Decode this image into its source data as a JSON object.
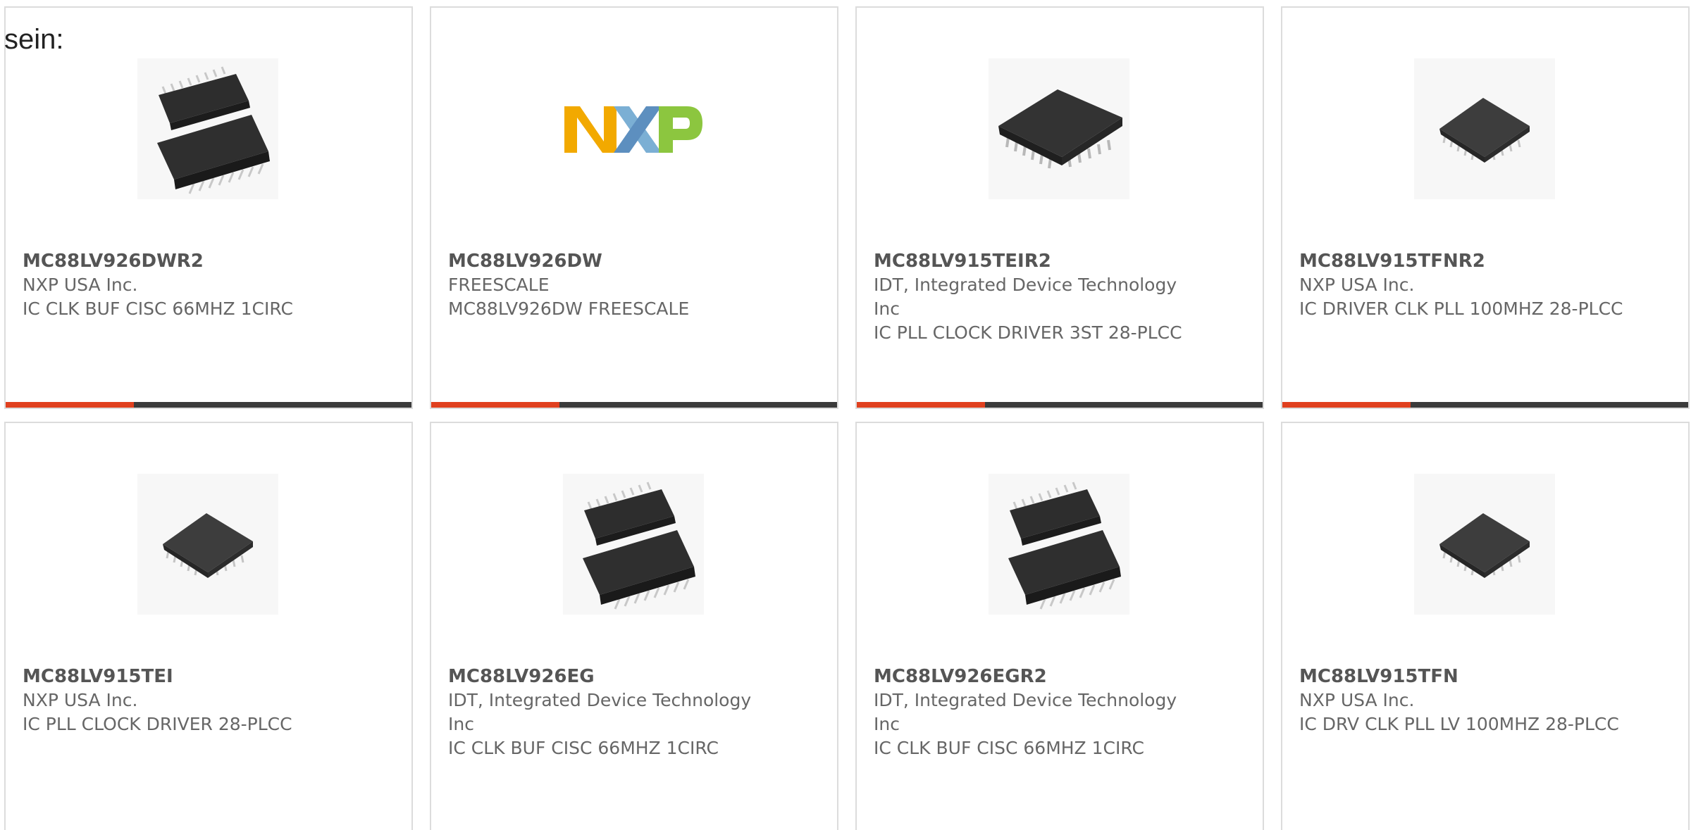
{
  "heading": "sein:",
  "colors": {
    "accent": "#e0401f",
    "bar": "#3b3b3b",
    "border": "#dcdcdc"
  },
  "products": [
    {
      "part": "MC88LV926DWR2",
      "manufacturer": "NXP USA Inc.",
      "description": "IC CLK BUF CISC 66MHZ 1CIRC",
      "image": "soic-chip-pair"
    },
    {
      "part": "MC88LV926DW",
      "manufacturer": "FREESCALE",
      "description": "MC88LV926DW FREESCALE",
      "image": "nxp-logo",
      "logo_text": "NXP"
    },
    {
      "part": "MC88LV915TEIR2",
      "manufacturer": "IDT, Integrated Device Technology Inc",
      "description": "IC PLL CLOCK DRIVER 3ST 28-PLCC",
      "image": "plcc-chip-large"
    },
    {
      "part": "MC88LV915TFNR2",
      "manufacturer": "NXP USA Inc.",
      "description": "IC DRIVER CLK PLL 100MHZ 28-PLCC",
      "image": "plcc-chip-small"
    },
    {
      "part": "MC88LV915TEI",
      "manufacturer": "NXP USA Inc.",
      "description": "IC PLL CLOCK DRIVER 28-PLCC",
      "image": "plcc-chip-small"
    },
    {
      "part": "MC88LV926EG",
      "manufacturer": "IDT, Integrated Device Technology Inc",
      "description": "IC CLK BUF CISC 66MHZ 1CIRC",
      "image": "soic-chip-pair"
    },
    {
      "part": "MC88LV926EGR2",
      "manufacturer": "IDT, Integrated Device Technology Inc",
      "description": "IC CLK BUF CISC 66MHZ 1CIRC",
      "image": "soic-chip-pair"
    },
    {
      "part": "MC88LV915TFN",
      "manufacturer": "NXP USA Inc.",
      "description": "IC DRV CLK PLL LV 100MHZ 28-PLCC",
      "image": "plcc-chip-small"
    }
  ]
}
